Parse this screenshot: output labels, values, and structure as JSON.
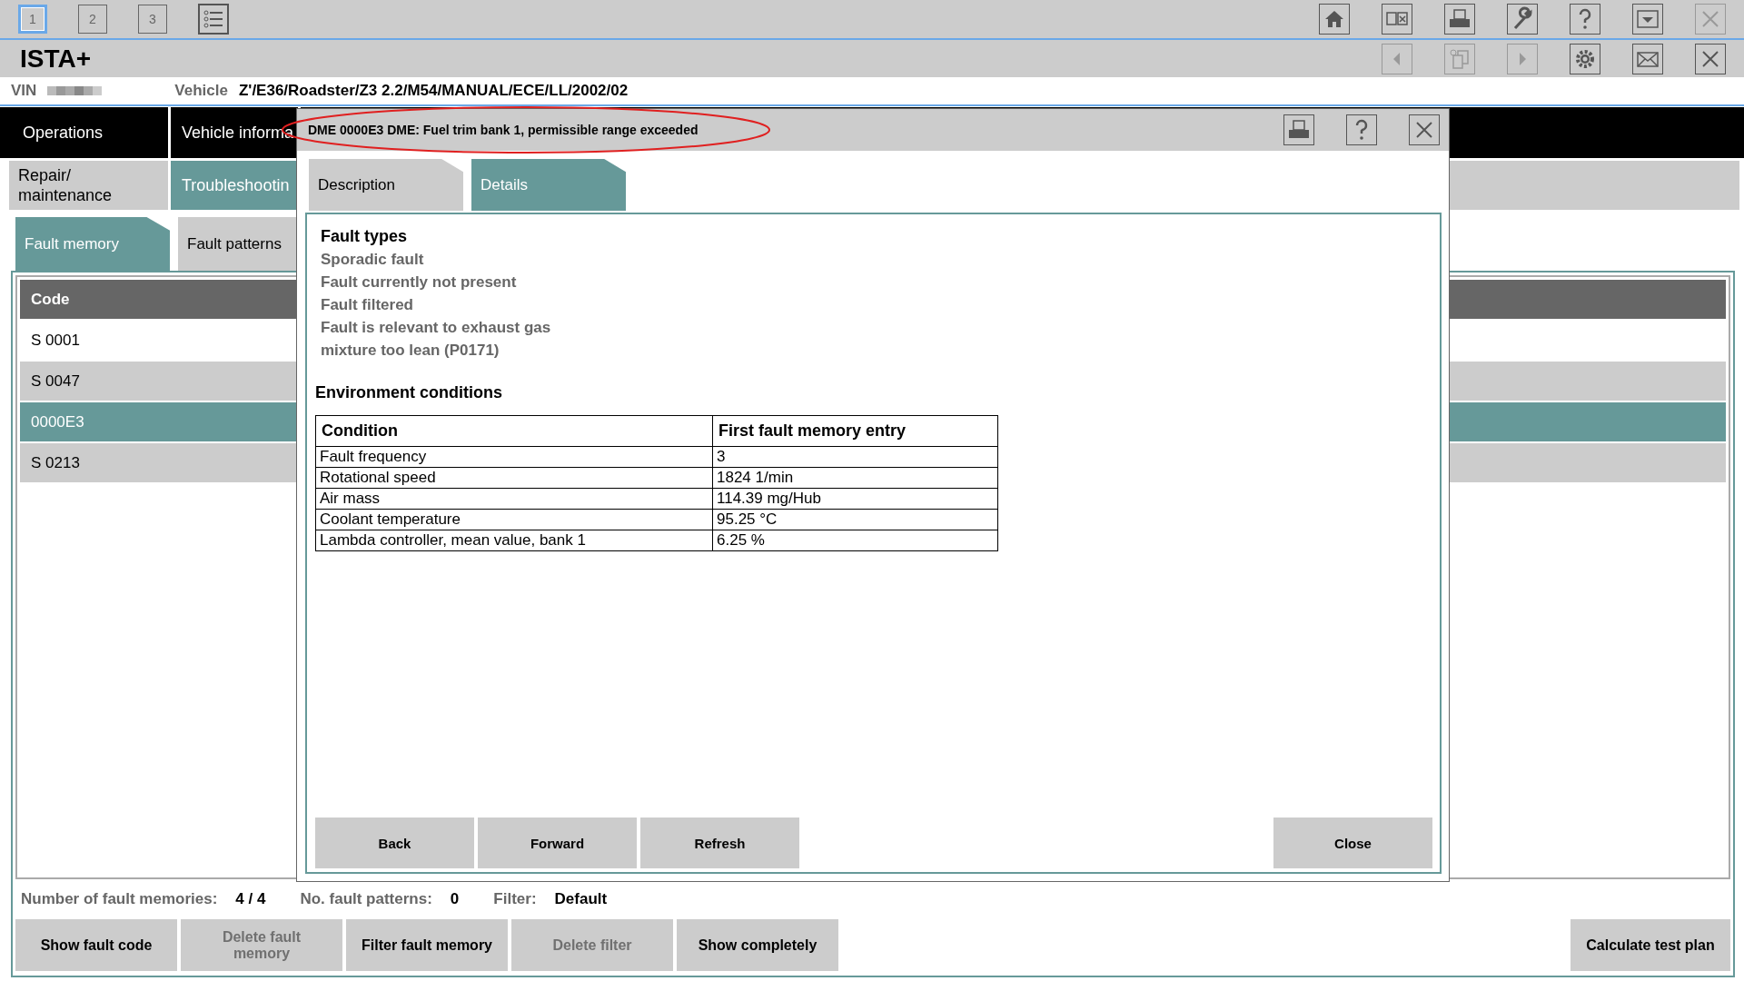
{
  "toolbar": {
    "tabs": [
      {
        "label": "1",
        "selected": true
      },
      {
        "label": "2",
        "selected": false
      },
      {
        "label": "3",
        "selected": false
      }
    ],
    "icons": [
      {
        "kind": "home",
        "disabled": false
      },
      {
        "kind": "compare",
        "disabled": false
      },
      {
        "kind": "print",
        "disabled": false
      },
      {
        "kind": "wrench",
        "disabled": false
      },
      {
        "kind": "help",
        "disabled": false
      },
      {
        "kind": "collapse",
        "disabled": false
      },
      {
        "kind": "close",
        "disabled": true
      }
    ]
  },
  "app_title": "ISTA+",
  "nav_icons": [
    {
      "kind": "back",
      "disabled": true
    },
    {
      "kind": "documents",
      "disabled": true
    },
    {
      "kind": "forward",
      "disabled": true
    },
    {
      "kind": "settings",
      "disabled": false
    },
    {
      "kind": "mail",
      "disabled": false
    },
    {
      "kind": "close",
      "disabled": false
    }
  ],
  "vin": {
    "label": "VIN"
  },
  "vehicle": {
    "label": "Vehicle",
    "value": "Z'/E36/Roadster/Z3 2.2/M54/MANUAL/ECE/LL/2002/02"
  },
  "main_tabs": [
    {
      "label": "Operations"
    },
    {
      "label": "Vehicle informa"
    }
  ],
  "sub_tabs": [
    {
      "label": "Repair/ maintenance",
      "selected": false
    },
    {
      "label": "Troubleshootin",
      "selected": true
    }
  ],
  "view_tabs": [
    {
      "label": "Fault memory",
      "selected": true
    },
    {
      "label": "Fault patterns",
      "selected": false
    }
  ],
  "fault_table": {
    "columns": [
      "Code"
    ],
    "rows": [
      {
        "code": "S 0001",
        "selected": false
      },
      {
        "code": "S 0047",
        "selected": false
      },
      {
        "code": "0000E3",
        "selected": true
      },
      {
        "code": "S 0213",
        "selected": false
      }
    ]
  },
  "status": [
    {
      "label": "Number of fault memories:",
      "value": "4 / 4"
    },
    {
      "label": "No. fault patterns:",
      "value": "0"
    },
    {
      "label": "Filter:",
      "value": "Default"
    }
  ],
  "buttons": [
    {
      "label": "Show fault code",
      "disabled": false
    },
    {
      "label": "Delete fault memory",
      "disabled": true
    },
    {
      "label": "Filter fault memory",
      "disabled": false
    },
    {
      "label": "Delete filter",
      "disabled": true
    },
    {
      "label": "Show completely",
      "disabled": false
    }
  ],
  "calculate_button": {
    "label": "Calculate test plan"
  },
  "dialog": {
    "title": "DME 0000E3 DME: Fuel trim bank 1, permissible range exceeded",
    "tabs": [
      {
        "label": "Description",
        "selected": false
      },
      {
        "label": "Details",
        "selected": true
      }
    ],
    "fault_types": {
      "heading": "Fault types",
      "items": [
        "Sporadic fault",
        "Fault currently not present",
        "Fault filtered",
        "Fault is relevant to exhaust gas",
        "mixture too lean (P0171)"
      ]
    },
    "environment": {
      "heading": "Environment conditions",
      "columns": [
        "Condition",
        "First fault memory entry"
      ],
      "rows": [
        [
          "Fault frequency",
          "3"
        ],
        [
          "Rotational speed",
          "1824 1/min"
        ],
        [
          "Air mass",
          "114.39 mg/Hub"
        ],
        [
          "Coolant temperature",
          "95.25 °C"
        ],
        [
          "Lambda controller, mean value, bank 1",
          "6.25 %"
        ]
      ]
    },
    "buttons": [
      "Back",
      "Forward",
      "Refresh"
    ],
    "close_button": "Close"
  }
}
